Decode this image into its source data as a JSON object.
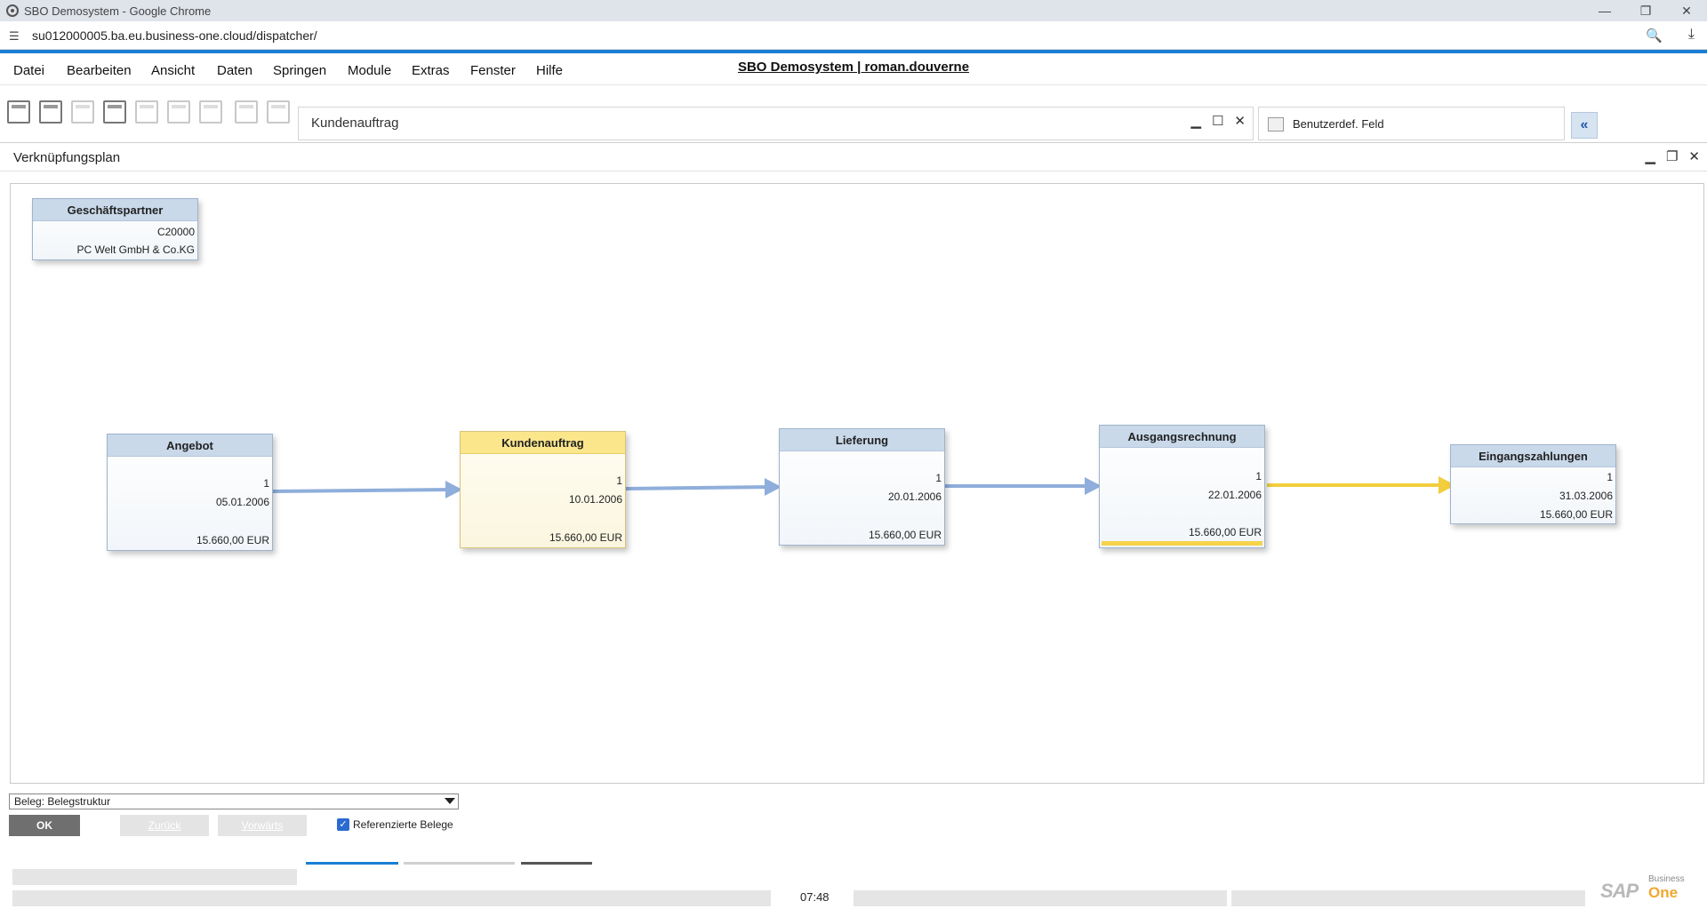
{
  "browser": {
    "title": "SBO Demosystem - Google Chrome",
    "url": "su012000005.ba.eu.business-one.cloud/dispatcher/"
  },
  "menu": {
    "items": [
      "Datei",
      "Bearbeiten",
      "Ansicht",
      "Daten",
      "Springen",
      "Module",
      "Extras",
      "Fenster",
      "Hilfe"
    ],
    "app_title": "SBO Demosystem | roman.douverne"
  },
  "bg_window": {
    "title": "Kundenauftrag"
  },
  "side_panel": {
    "label": "Benutzerdef. Feld",
    "collapse": "«"
  },
  "main_window": {
    "title": "Verknüpfungsplan"
  },
  "nodes": {
    "partner": {
      "title": "Geschäftspartner",
      "code": "C20000",
      "name": "PC Welt GmbH & Co.KG"
    },
    "angebot": {
      "title": "Angebot",
      "num": "1",
      "date": "05.01.2006",
      "amount": "15.660,00 EUR"
    },
    "kundenauftrag": {
      "title": "Kundenauftrag",
      "num": "1",
      "date": "10.01.2006",
      "amount": "15.660,00 EUR"
    },
    "lieferung": {
      "title": "Lieferung",
      "num": "1",
      "date": "20.01.2006",
      "amount": "15.660,00 EUR"
    },
    "ausgangsrechnung": {
      "title": "Ausgangsrechnung",
      "num": "1",
      "date": "22.01.2006",
      "amount": "15.660,00 EUR"
    },
    "eingangszahlungen": {
      "title": "Eingangszahlungen",
      "num": "1",
      "date": "31.03.2006",
      "amount": "15.660,00 EUR"
    }
  },
  "colors": {
    "link_blue": "#8faedb",
    "link_yellow": "#f2cd3d",
    "active_header": "#fbe68c",
    "node_header": "#c9d9ea"
  },
  "controls": {
    "beleg_select": "Beleg: Belegstruktur",
    "ok": "OK",
    "zurueck": "Zurück",
    "vorwaerts": "Vorwärts",
    "referenced_label": "Referenzierte Belege",
    "referenced_checked": true
  },
  "status": {
    "clock": "07:48",
    "logo_business": "Business",
    "logo_one": "One",
    "logo_sap": "SAP"
  }
}
